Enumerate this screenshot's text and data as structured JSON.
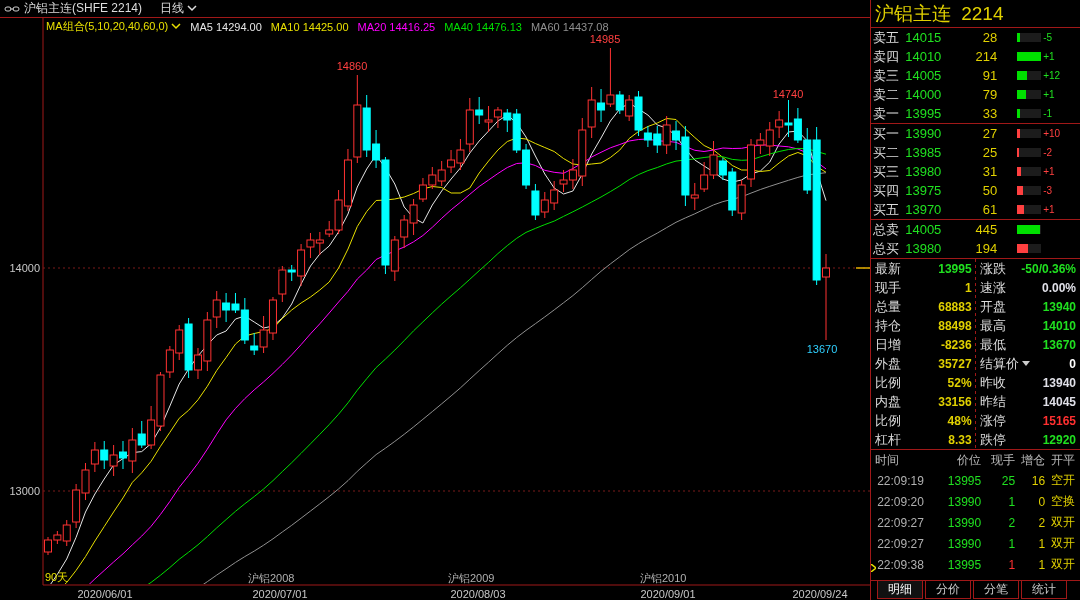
{
  "toolbar": {
    "title": "沪铝主连(SHFE 2214)",
    "period": "日线"
  },
  "ma_legend": {
    "selector": "MA组合(5,10,20,40,60,0)",
    "lines": [
      {
        "label": "MA5 14294.00",
        "color": "#e6e6e6"
      },
      {
        "label": "MA10 14425.00",
        "color": "#e8e000"
      },
      {
        "label": "MA20 14416.25",
        "color": "#ff00ff"
      },
      {
        "label": "MA40 14476.13",
        "color": "#00e000"
      },
      {
        "label": "MA60 14437.08",
        "color": "#909090"
      }
    ]
  },
  "chart": {
    "price_labels": [
      "14000",
      "13000"
    ],
    "annotations": [
      {
        "text": "14860",
        "kind": "high"
      },
      {
        "text": "14985",
        "kind": "high"
      },
      {
        "text": "14740",
        "kind": "high"
      },
      {
        "text": "13670",
        "kind": "low"
      }
    ],
    "period_label": "90天",
    "contract_labels": [
      "沪铝2008",
      "沪铝2009",
      "沪铝2010"
    ],
    "dates": [
      "2020/06/01",
      "2020/07/01",
      "2020/08/03",
      "2020/09/01",
      "2020/09/24"
    ]
  },
  "quote": {
    "name": "沪铝主连",
    "code": "2214"
  },
  "asks": [
    {
      "label": "卖五",
      "price": "14015",
      "volume": "28",
      "level": 0.1,
      "change": "-5"
    },
    {
      "label": "卖四",
      "price": "14010",
      "volume": "214",
      "level": 1,
      "change": "+1"
    },
    {
      "label": "卖三",
      "price": "14005",
      "volume": "91",
      "level": 0.42,
      "change": "+12"
    },
    {
      "label": "卖二",
      "price": "14000",
      "volume": "79",
      "level": 0.37,
      "change": "+1"
    },
    {
      "label": "卖一",
      "price": "13995",
      "volume": "33",
      "level": 0.12,
      "change": "-1"
    }
  ],
  "bids": [
    {
      "label": "买一",
      "price": "13990",
      "volume": "27",
      "level": 0.12,
      "change": "+10"
    },
    {
      "label": "买二",
      "price": "13985",
      "volume": "25",
      "level": 0.08,
      "change": "-2"
    },
    {
      "label": "买三",
      "price": "13980",
      "volume": "31",
      "level": 0.14,
      "change": "+1"
    },
    {
      "label": "买四",
      "price": "13975",
      "volume": "50",
      "level": 0.23,
      "change": "-3"
    },
    {
      "label": "买五",
      "price": "13970",
      "volume": "61",
      "level": 0.28,
      "change": "+1"
    }
  ],
  "totals": [
    {
      "label": "总卖",
      "price": "14005",
      "volume": "445",
      "level": 0.95,
      "color": "#00e000"
    },
    {
      "label": "总买",
      "price": "13980",
      "volume": "194",
      "level": 0.45,
      "color": "#ff4040"
    }
  ],
  "stats": [
    {
      "label": "最新",
      "value": "13995",
      "color": "#20e020",
      "kind": "plain"
    },
    {
      "label": "涨跌",
      "value": "-50/0.36%",
      "color": "#20e020",
      "kind": "plain"
    },
    {
      "label": "现手",
      "value": "1",
      "color": "#e0d000",
      "kind": "plain"
    },
    {
      "label": "速涨",
      "value": "0.00%",
      "color": "#e0e0e8",
      "kind": "plain"
    },
    {
      "label": "总量",
      "value": "68883",
      "color": "#e0d000",
      "kind": "plain"
    },
    {
      "label": "开盘",
      "value": "13940",
      "color": "#20e020",
      "kind": "plain"
    },
    {
      "label": "持仓",
      "value": "88498",
      "color": "#e0d000",
      "kind": "plain"
    },
    {
      "label": "最高",
      "value": "14010",
      "color": "#20e020",
      "kind": "plain"
    },
    {
      "label": "日增",
      "value": "-8236",
      "color": "#e0d000",
      "kind": "plain"
    },
    {
      "label": "最低",
      "value": "13670",
      "color": "#20e020",
      "kind": "plain"
    },
    {
      "label": "外盘",
      "value": "35727",
      "color": "#e0d000",
      "kind": "plain"
    },
    {
      "label": "结算价",
      "value": "0",
      "color": "#ffffff",
      "kind": "dropdown"
    },
    {
      "label": "比例",
      "value": "52%",
      "color": "#e0d000",
      "kind": "plain"
    },
    {
      "label": "昨收",
      "value": "13940",
      "color": "#e0e0e8",
      "kind": "plain"
    },
    {
      "label": "内盘",
      "value": "33156",
      "color": "#e0d000",
      "kind": "plain"
    },
    {
      "label": "昨结",
      "value": "14045",
      "color": "#e0e0e8",
      "kind": "plain"
    },
    {
      "label": "比例",
      "value": "48%",
      "color": "#e0d000",
      "kind": "plain"
    },
    {
      "label": "涨停",
      "value": "15165",
      "color": "#ff3030",
      "kind": "plain"
    },
    {
      "label": "杠杆",
      "value": "8.33",
      "color": "#e0d000",
      "kind": "plain"
    },
    {
      "label": "跌停",
      "value": "12920",
      "color": "#20e020",
      "kind": "plain"
    }
  ],
  "trades": {
    "columns": [
      "时间",
      "价位",
      "现手",
      "增仓",
      "开平"
    ],
    "rows": [
      {
        "time": "22:09:19",
        "price": "13995",
        "hand": "25",
        "color": "#20e020",
        "oi": "16",
        "type": "空开",
        "selected": false
      },
      {
        "time": "22:09:20",
        "price": "13990",
        "hand": "1",
        "color": "#20e020",
        "oi": "0",
        "type": "空换",
        "selected": false
      },
      {
        "time": "22:09:27",
        "price": "13990",
        "hand": "2",
        "color": "#20e020",
        "oi": "2",
        "type": "双开",
        "selected": false
      },
      {
        "time": "22:09:27",
        "price": "13990",
        "hand": "1",
        "color": "#20e020",
        "oi": "1",
        "type": "双开",
        "selected": false
      },
      {
        "time": "22:09:38",
        "price": "13995",
        "hand": "1",
        "color": "#ff3030",
        "oi": "1",
        "type": "双开",
        "selected": true
      }
    ]
  },
  "tabs": [
    {
      "label": "明细",
      "selected": true
    },
    {
      "label": "分价",
      "selected": false
    },
    {
      "label": "分笔",
      "selected": false
    },
    {
      "label": "统计",
      "selected": false
    }
  ]
}
